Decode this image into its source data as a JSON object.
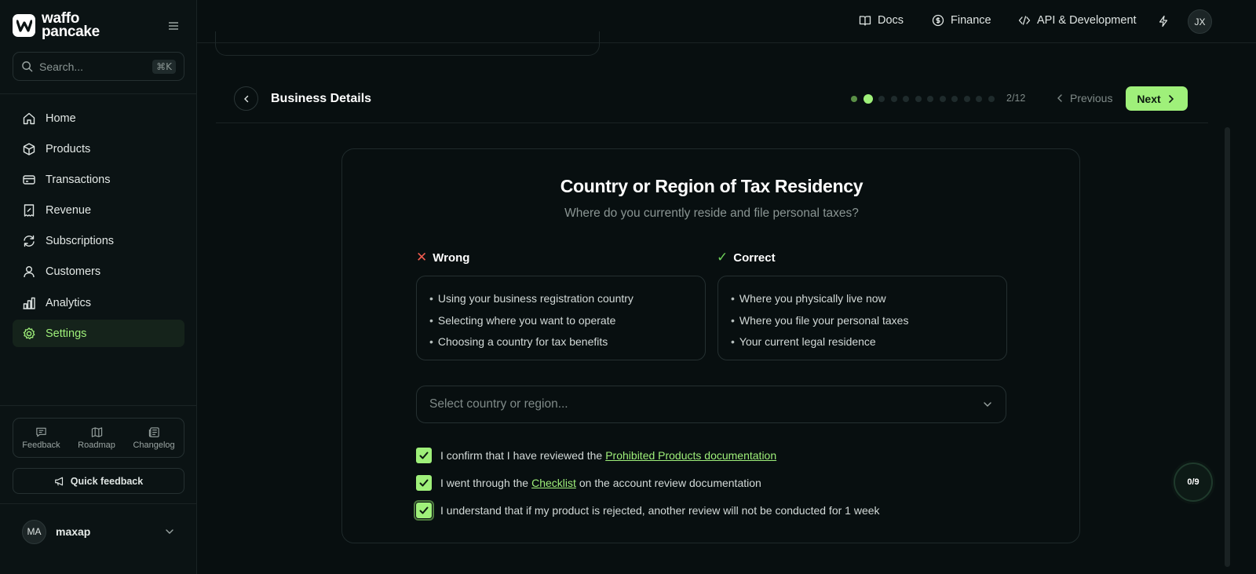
{
  "brand": {
    "line1": "waffo",
    "line2": "pancake",
    "accent": "#9ff07a"
  },
  "search": {
    "placeholder": "Search...",
    "shortcut": "⌘K"
  },
  "sidebar": {
    "items": [
      {
        "label": "Home",
        "icon": "home-icon"
      },
      {
        "label": "Products",
        "icon": "box-icon"
      },
      {
        "label": "Transactions",
        "icon": "credit-card-icon"
      },
      {
        "label": "Revenue",
        "icon": "receipt-icon"
      },
      {
        "label": "Subscriptions",
        "icon": "refresh-icon"
      },
      {
        "label": "Customers",
        "icon": "user-icon"
      },
      {
        "label": "Analytics",
        "icon": "bar-chart-icon"
      },
      {
        "label": "Settings",
        "icon": "gear-icon",
        "active": true
      }
    ],
    "footer_links": [
      {
        "label": "Feedback",
        "icon": "message-icon"
      },
      {
        "label": "Roadmap",
        "icon": "map-icon"
      },
      {
        "label": "Changelog",
        "icon": "newspaper-icon"
      }
    ],
    "quick_feedback": "Quick feedback",
    "user": {
      "initials": "MA",
      "name": "maxap"
    }
  },
  "topbar": {
    "links": [
      {
        "label": "Docs",
        "icon": "book-icon"
      },
      {
        "label": "Finance",
        "icon": "dollar-circle-icon"
      },
      {
        "label": "API & Development",
        "icon": "code-icon"
      }
    ],
    "avatar_initials": "JX"
  },
  "step": {
    "title": "Business Details",
    "current": 2,
    "total": 12,
    "counter": "2/12",
    "previous_label": "Previous",
    "next_label": "Next"
  },
  "card": {
    "title": "Country or Region of Tax Residency",
    "subtitle": "Where do you currently reside and file personal taxes?",
    "wrong": {
      "heading": "Wrong",
      "items": [
        "Using your business registration country",
        "Selecting where you want to operate",
        "Choosing a country for tax benefits"
      ]
    },
    "correct": {
      "heading": "Correct",
      "items": [
        "Where you physically live now",
        "Where you file your personal taxes",
        "Your current legal residence"
      ]
    },
    "select_placeholder": "Select country or region...",
    "checks": [
      {
        "before": "I confirm that I have reviewed the",
        "link": "Prohibited Products documentation",
        "after": "",
        "checked": true
      },
      {
        "before": "I went through the",
        "link": "Checklist",
        "after": "on the account review documentation",
        "checked": true
      },
      {
        "before": "I understand that if my product is rejected, another review will not be conducted for 1 week",
        "link": "",
        "after": "",
        "checked": true
      }
    ]
  },
  "progress_badge": "0/9"
}
